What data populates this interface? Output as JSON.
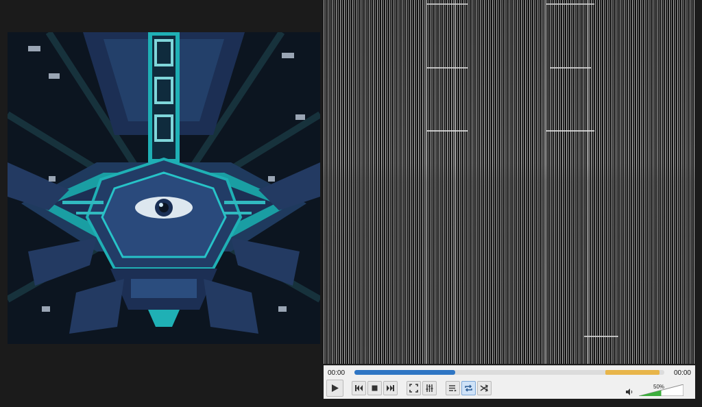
{
  "player": {
    "time_elapsed": "00:00",
    "time_total": "00:00",
    "progress_fraction": 0.326,
    "buffer_start_fraction": 0.81,
    "buffer_end_fraction": 0.985,
    "volume_label": "50%",
    "volume_fraction": 0.5
  },
  "controls": {
    "play": "play-icon",
    "prev": "previous-icon",
    "stop": "stop-icon",
    "next": "next-icon",
    "fullscreen": "fullscreen-icon",
    "extended": "equalizer-icon",
    "playlist": "playlist-icon",
    "loop": "loop-icon",
    "random": "shuffle-icon",
    "volume": "speaker-icon"
  },
  "colors": {
    "seek_fill": "#2f76c4",
    "buffer": "#e8b54a",
    "volume_fill": "#3cae3c",
    "art_teal": "#1fb0b5",
    "art_navy": "#1c2f54"
  }
}
